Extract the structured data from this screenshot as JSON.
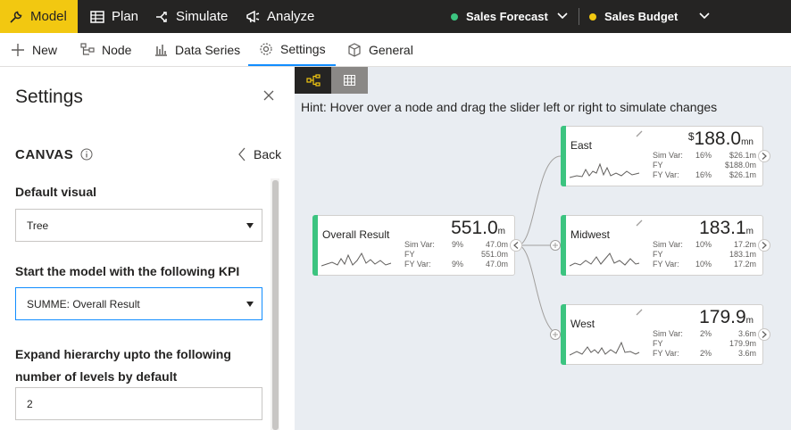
{
  "topbar": {
    "tabs": [
      {
        "label": "Model",
        "icon": "wrench-icon"
      },
      {
        "label": "Plan",
        "icon": "table-icon"
      },
      {
        "label": "Simulate",
        "icon": "simulate-icon"
      },
      {
        "label": "Analyze",
        "icon": "megaphone-icon"
      }
    ],
    "scenarios": [
      {
        "label": "Sales Forecast",
        "color": "#3cc480"
      },
      {
        "label": "Sales Budget",
        "color": "#f2c811"
      }
    ]
  },
  "toolbar": {
    "items": [
      {
        "label": "New",
        "icon": "plus-icon"
      },
      {
        "label": "Node",
        "icon": "node-icon"
      },
      {
        "label": "Data Series",
        "icon": "bar-chart-icon"
      },
      {
        "label": "Settings",
        "icon": "gear-icon"
      },
      {
        "label": "General",
        "icon": "cube-icon"
      }
    ]
  },
  "settings": {
    "title": "Settings",
    "section": "CANVAS",
    "back_label": "Back",
    "default_visual_label": "Default visual",
    "default_visual_value": "Tree",
    "kpi_label": "Start the model with the following KPI",
    "kpi_value": "SUMME: Overall Result",
    "expand_label": "Expand hierarchy upto the following number of levels by default",
    "expand_value": "2"
  },
  "canvas": {
    "hint": "Hint: Hover over a node and drag the slider left or right to simulate changes",
    "nodes": [
      {
        "name": "Overall Result",
        "currency": "",
        "value": "551.0",
        "unit": "m",
        "rows": [
          {
            "label": "Sim Var:",
            "pct": "9%",
            "val": "47.0m"
          },
          {
            "label": "FY",
            "pct": "",
            "val": "551.0m"
          },
          {
            "label": "FY Var:",
            "pct": "9%",
            "val": "47.0m"
          }
        ]
      },
      {
        "name": "East",
        "currency": "$",
        "value": "188.0",
        "unit": "mn",
        "rows": [
          {
            "label": "Sim Var:",
            "pct": "16%",
            "val": "$26.1m"
          },
          {
            "label": "FY",
            "pct": "",
            "val": "$188.0m"
          },
          {
            "label": "FY Var:",
            "pct": "16%",
            "val": "$26.1m"
          }
        ]
      },
      {
        "name": "Midwest",
        "currency": "",
        "value": "183.1",
        "unit": "m",
        "rows": [
          {
            "label": "Sim Var:",
            "pct": "10%",
            "val": "17.2m"
          },
          {
            "label": "FY",
            "pct": "",
            "val": "183.1m"
          },
          {
            "label": "FY Var:",
            "pct": "10%",
            "val": "17.2m"
          }
        ]
      },
      {
        "name": "West",
        "currency": "",
        "value": "179.9",
        "unit": "m",
        "rows": [
          {
            "label": "Sim Var:",
            "pct": "2%",
            "val": "3.6m"
          },
          {
            "label": "FY",
            "pct": "",
            "val": "179.9m"
          },
          {
            "label": "FY Var:",
            "pct": "2%",
            "val": "3.6m"
          }
        ]
      }
    ],
    "accent": "#3cc480"
  }
}
